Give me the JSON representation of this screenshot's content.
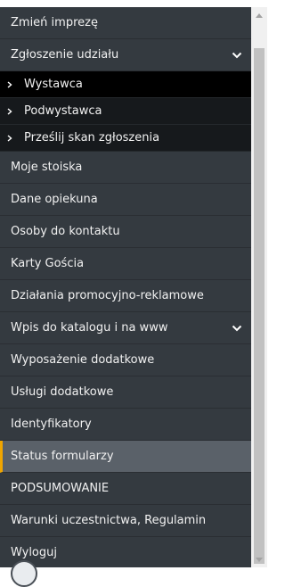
{
  "menu": {
    "change_event": "Zmień imprezę",
    "registration": {
      "label": "Zgłoszenie udziału",
      "children": [
        "Wystawca",
        "Podwystawca",
        "Prześlij skan zgłoszenia"
      ]
    },
    "my_stands": "Moje stoiska",
    "guardian_data": "Dane opiekuna",
    "contacts": "Osoby do kontaktu",
    "guest_cards": "Karty Gościa",
    "promo": "Działania promocyjno-reklamowe",
    "catalog": "Wpis do katalogu i na www",
    "extra_equipment": "Wyposażenie dodatkowe",
    "extra_services": "Usługi dodatkowe",
    "badges": "Identyfikatory",
    "forms_status": "Status formularzy",
    "summary": "PODSUMOWANIE",
    "terms": "Warunki uczestnictwa, Regulamin",
    "logout": "Wyloguj"
  },
  "state": {
    "active_item": "Status formularzy",
    "selected_subitem": "Wystawca",
    "scroll_position": 0.05
  },
  "colors": {
    "sidebar_bg": "#343a40",
    "submenu_bg": "#16191c",
    "active_bg": "#5a6169",
    "active_accent": "#f0a500"
  }
}
